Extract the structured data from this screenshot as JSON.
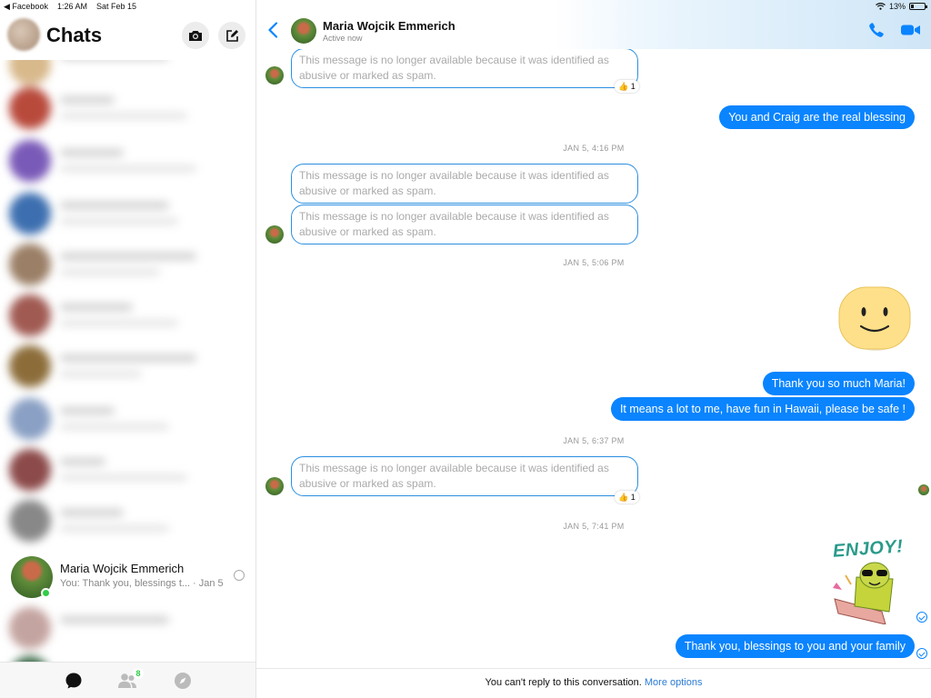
{
  "status_bar": {
    "back_app": "◀ Facebook",
    "time": "1:26 AM",
    "date": "Sat Feb 15",
    "battery": "13%"
  },
  "sidebar": {
    "title": "Chats",
    "active_chat": {
      "name": "Maria Wojcik Emmerich",
      "preview": "You: Thank you, blessings t...",
      "date": "· Jan 5"
    },
    "tabs": {
      "people_badge": "8"
    }
  },
  "conversation": {
    "contact_name": "Maria Wojcik Emmerich",
    "contact_status": "Active now",
    "messages": {
      "removed_text": "This message is no longer available because it was identified as abusive or marked as spam.",
      "reaction_count": "1",
      "sent_1": "You and Craig are the real blessing",
      "sent_2": "Thank you so much Maria!",
      "sent_3": "It means a lot to me, have fun in Hawaii, please be safe !",
      "sent_4": "Thank you, blessings to you and your family",
      "sticker_text": "ENJOY!"
    },
    "timestamps": {
      "t1": "JAN 5, 4:16 PM",
      "t2": "JAN 5, 5:06 PM",
      "t3": "JAN 5, 6:37 PM",
      "t4": "JAN 5, 7:41 PM"
    },
    "footer": {
      "notice": "You can't reply to this conversation. ",
      "link": "More options"
    }
  },
  "colors": {
    "accent": "#0a84ff",
    "online": "#31cc46"
  }
}
